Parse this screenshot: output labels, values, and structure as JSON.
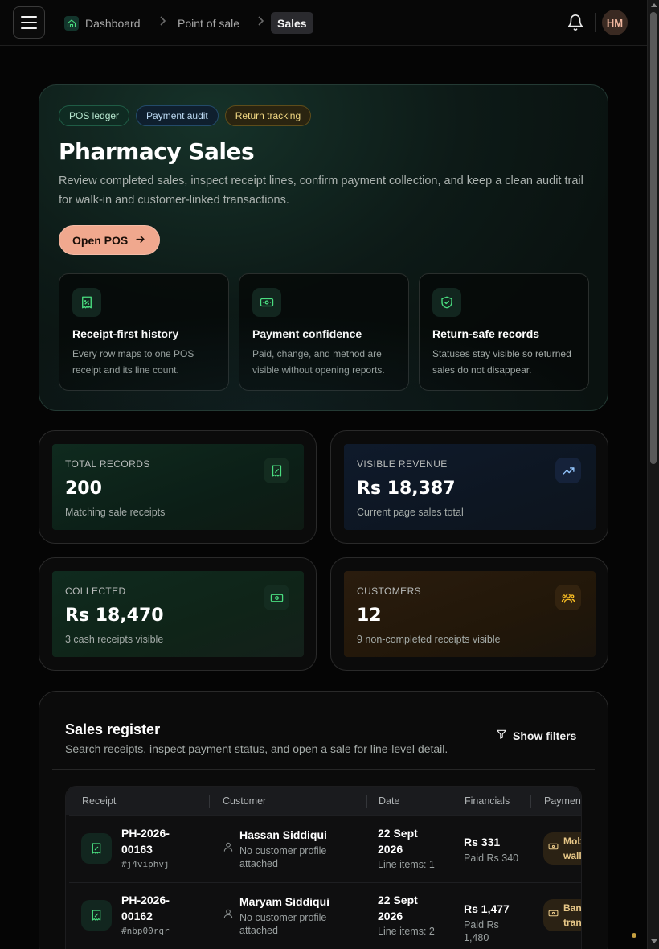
{
  "topbar": {
    "breadcrumb": [
      "Dashboard",
      "Point of sale",
      "Sales"
    ],
    "avatar_initials": "HM"
  },
  "hero": {
    "tags": [
      "POS ledger",
      "Payment audit",
      "Return tracking"
    ],
    "title": "Pharmacy Sales",
    "description": "Review completed sales, inspect receipt lines, confirm payment collection, and keep a clean audit trail for walk-in and customer-linked transactions.",
    "cta_label": "Open POS",
    "features": [
      {
        "icon": "receipt-icon",
        "title": "Receipt-first history",
        "description": "Every row maps to one POS receipt and its line count."
      },
      {
        "icon": "banknote-icon",
        "title": "Payment confidence",
        "description": "Paid, change, and method are visible without opening reports."
      },
      {
        "icon": "shield-check-icon",
        "title": "Return-safe records",
        "description": "Statuses stay visible so returned sales do not disappear."
      }
    ]
  },
  "stats": [
    {
      "label": "TOTAL RECORDS",
      "value": "200",
      "sub": "Matching sale receipts",
      "icon": "receipt-icon",
      "accent": "#4ade80"
    },
    {
      "label": "VISIBLE REVENUE",
      "value": "Rs 18,387",
      "sub": "Current page sales total",
      "icon": "trending-up-icon",
      "accent": "#93c5fd"
    },
    {
      "label": "COLLECTED",
      "value": "Rs 18,470",
      "sub": "3 cash receipts visible",
      "icon": "banknote-icon",
      "accent": "#4ade80"
    },
    {
      "label": "CUSTOMERS",
      "value": "12",
      "sub": "9 non-completed receipts visible",
      "icon": "users-icon",
      "accent": "#fbbf24"
    }
  ],
  "register": {
    "title": "Sales register",
    "subtitle": "Search receipts, inspect payment status, and open a sale for line-level detail.",
    "filters_label": "Show filters",
    "columns": [
      "Receipt",
      "Customer",
      "Date",
      "Financials",
      "Payment"
    ],
    "rows": [
      {
        "receipt": "PH-2026-00163",
        "code": "#j4viphvj",
        "customer": "Hassan Siddiqui",
        "customer_note": "No customer profile attached",
        "date": "22 Sept 2026",
        "line_items": "Line items: 1",
        "amount": "Rs 331",
        "paid": "Paid Rs 340",
        "payment": "Mobile wallet"
      },
      {
        "receipt": "PH-2026-00162",
        "code": "#nbp00rqr",
        "customer": "Maryam Siddiqui",
        "customer_note": "No customer profile attached",
        "date": "22 Sept 2026",
        "line_items": "Line items: 2",
        "amount": "Rs 1,477",
        "paid": "Paid Rs 1,480",
        "payment": "Bank transfer"
      }
    ]
  },
  "colors": {
    "accent_primary": "#f0a88e",
    "brand_green": "#4ade80"
  }
}
